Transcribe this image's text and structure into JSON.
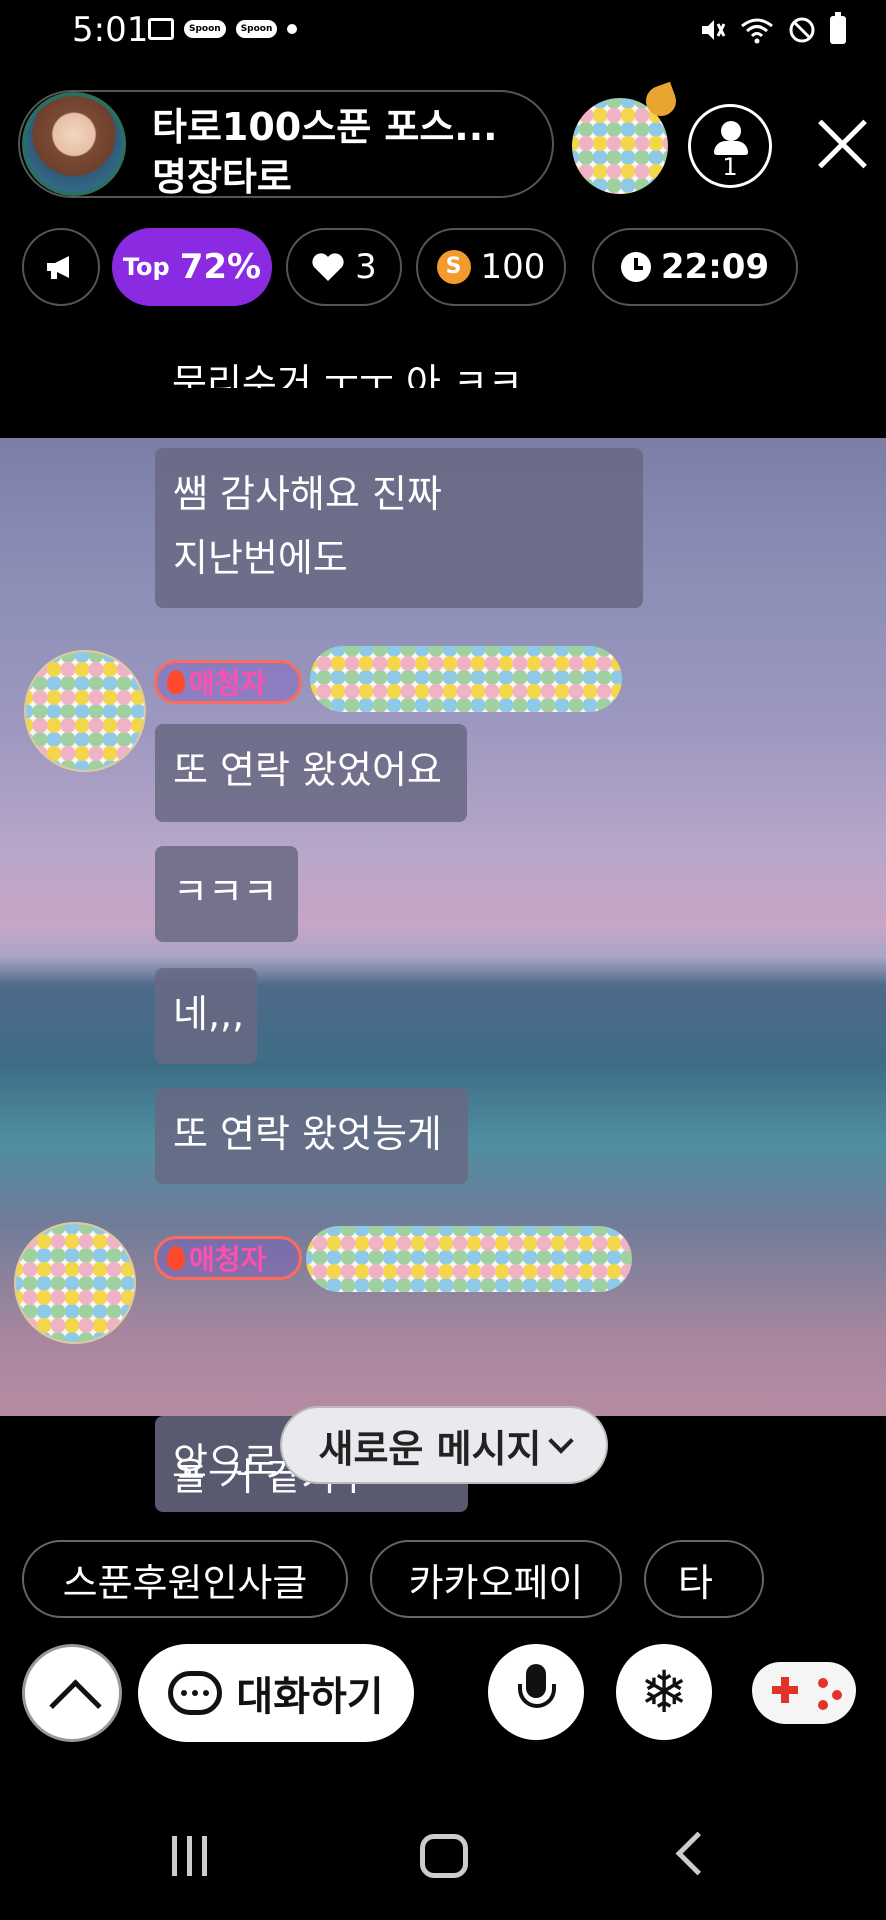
{
  "status_bar": {
    "time": "5:01",
    "chips": [
      "Spoon",
      "Spoon"
    ],
    "icons": [
      "image-icon",
      "spoon-chip",
      "spoon-chip",
      "dot",
      "mute-icon",
      "wifi-icon",
      "do-not-disturb-icon",
      "battery-icon"
    ]
  },
  "header": {
    "title": "타로100스푼 포스...",
    "subtitle": "명장타로",
    "listener_count": "1"
  },
  "stats": {
    "top_prefix": "Top",
    "top_value": "72%",
    "likes": "3",
    "spoons": "100",
    "spoon_coin": "S",
    "timer": "22:09"
  },
  "chat": {
    "cut_top": "문리수거 ㅜㅜ 아 ㅋㅋ",
    "message1_line1": "쌤 감사해요 진짜",
    "message1_line2": "지난번에도",
    "badge1": "애청자",
    "message2": "또 연락 왔었어요",
    "message3": "ㅋㅋㅋ",
    "message4": "네,,,",
    "message5": "또 연락 왔엇능게",
    "badge2": "애청자",
    "message6": "앞으로도 또 연락",
    "behind": "올 거 같기두",
    "new_message": "새로운 메시지"
  },
  "quick_replies": [
    "스푼후원인사글",
    "카카오페이",
    "타"
  ],
  "controls": {
    "chat_label": "대화하기",
    "snow": "❄"
  }
}
